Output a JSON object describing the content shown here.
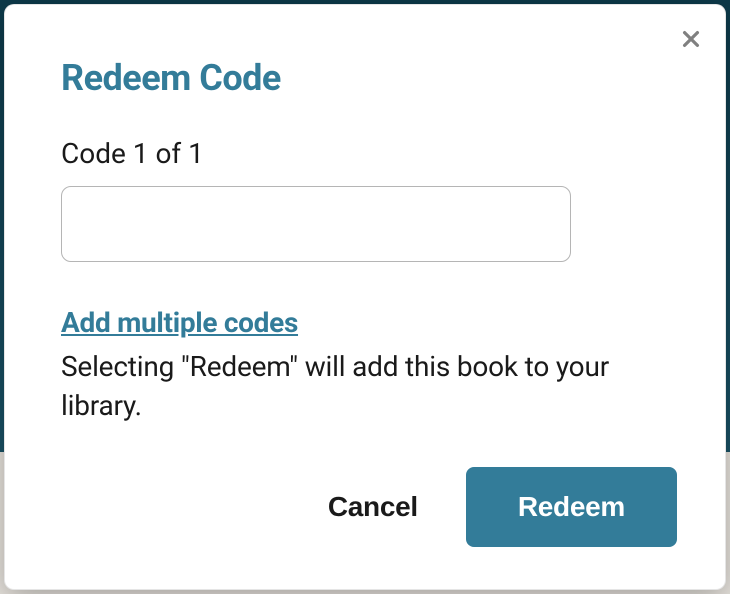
{
  "modal": {
    "title": "Redeem Code",
    "code_label": "Code 1 of 1",
    "code_value": "",
    "add_multiple_link": "Add multiple codes",
    "helper_text": "Selecting \"Redeem\" will add this book to your library.",
    "cancel_label": "Cancel",
    "redeem_label": "Redeem"
  }
}
